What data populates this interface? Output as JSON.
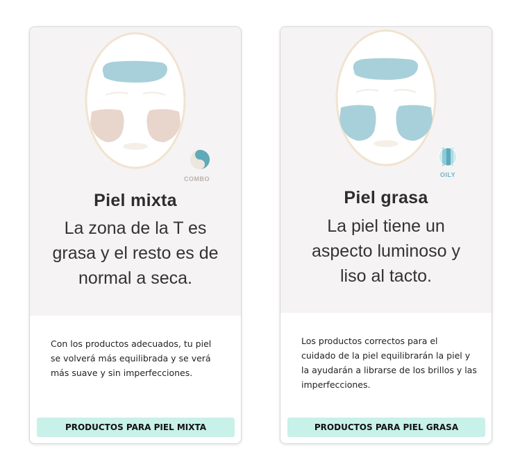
{
  "colors": {
    "hero_bg": "#f5f3f4",
    "button_bg": "#c8f1e9",
    "face_outline": "#f1e3cf",
    "oil_zone": "#a8d0da",
    "dry_zone": "#e8d5cc"
  },
  "cards": [
    {
      "badge_icon": "combination-skin-icon",
      "badge_label": "COMBO",
      "title": "Piel mixta",
      "subtitle_lines": [
        "La zona de la T es",
        "grasa y el resto es de",
        "normal a seca."
      ],
      "description_lines": [
        "Con los productos adecuados, tu piel",
        "se volverá más equilibrada y se verá",
        "más suave y sin imperfecciones."
      ],
      "button_label": "PRODUCTOS PARA PIEL MIXTA"
    },
    {
      "badge_icon": "oily-skin-icon",
      "badge_label": "OILY",
      "title": "Piel grasa",
      "subtitle_lines": [
        "La piel tiene un",
        "aspecto luminoso y",
        "liso al tacto."
      ],
      "description_lines": [
        "Los productos correctos para el",
        "cuidado de la piel equilibrarán la piel y",
        "la ayudarán a librarse de los brillos y las",
        "imperfecciones."
      ],
      "button_label": "PRODUCTOS PARA PIEL GRASA"
    }
  ]
}
